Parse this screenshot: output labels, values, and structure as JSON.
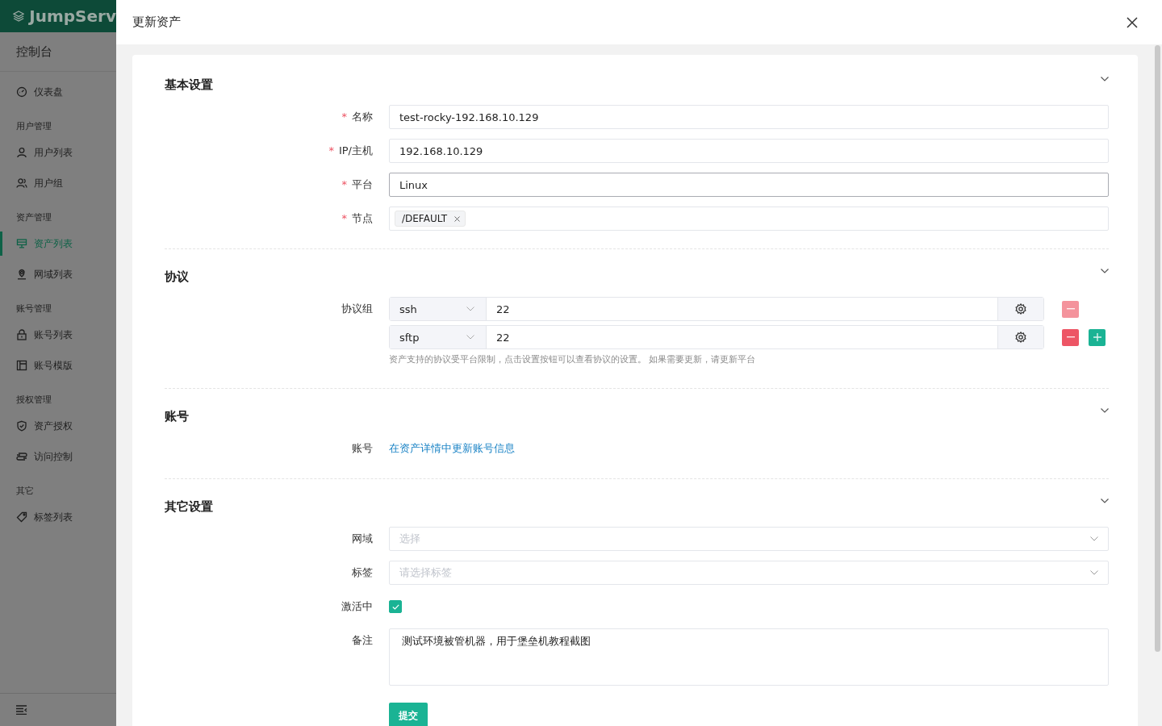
{
  "sidebar": {
    "logo": "JumpServ",
    "title": "控制台",
    "groups": [
      {
        "items": [
          {
            "label": "仪表盘",
            "kind": "dashboard",
            "selected": false
          }
        ]
      },
      {
        "title": "用户管理",
        "items": [
          {
            "label": "用户列表",
            "kind": "user",
            "selected": false
          },
          {
            "label": "用户组",
            "kind": "users",
            "selected": false
          }
        ]
      },
      {
        "title": "资产管理",
        "items": [
          {
            "label": "资产列表",
            "kind": "monitor",
            "selected": true
          },
          {
            "label": "网域列表",
            "kind": "location",
            "selected": false
          }
        ]
      },
      {
        "title": "账号管理",
        "items": [
          {
            "label": "账号列表",
            "kind": "lock",
            "selected": false
          },
          {
            "label": "账号模版",
            "kind": "template",
            "selected": false
          }
        ]
      },
      {
        "title": "授权管理",
        "items": [
          {
            "label": "资产授权",
            "kind": "shield",
            "selected": false
          },
          {
            "label": "访问控制",
            "kind": "access",
            "selected": false
          }
        ]
      },
      {
        "title": "其它",
        "items": [
          {
            "label": "标签列表",
            "kind": "tag",
            "selected": false
          }
        ]
      }
    ]
  },
  "drawer": {
    "title": "更新资产",
    "sections": [
      {
        "title": "基本设置",
        "expanded": true,
        "fields": [
          {
            "kind": "text",
            "label": "名称",
            "required_mark": "*",
            "value": "test-rocky-192.168.10.129",
            "focused": false
          },
          {
            "kind": "text",
            "label": "IP/主机",
            "required_mark": "*",
            "value": "192.168.10.129",
            "focused": false
          },
          {
            "kind": "text",
            "label": "平台",
            "required_mark": "*",
            "value": "Linux",
            "focused": true
          },
          {
            "kind": "tags",
            "label": "节点",
            "required_mark": "*",
            "tags": [
              "/DEFAULT"
            ]
          }
        ]
      },
      {
        "title": "协议",
        "expanded": true,
        "fields": [
          {
            "kind": "protocols",
            "label": "协议组",
            "rows": [
              {
                "protocol": "ssh",
                "port": "22",
                "remove_disabled": true
              },
              {
                "protocol": "sftp",
                "port": "22",
                "remove_disabled": false
              }
            ],
            "help": "资产支持的协议受平台限制，点击设置按钮可以查看协议的设置。 如果需要更新，请更新平台"
          }
        ]
      },
      {
        "title": "账号",
        "expanded": true,
        "fields": [
          {
            "kind": "link",
            "label": "账号",
            "text": "在资产详情中更新账号信息"
          }
        ]
      },
      {
        "title": "其它设置",
        "expanded": true,
        "fields": [
          {
            "kind": "select",
            "label": "网域",
            "placeholder": "选择"
          },
          {
            "kind": "select",
            "label": "标签",
            "placeholder": "请选择标签"
          },
          {
            "kind": "checkbox",
            "label": "激活中",
            "checked": true
          },
          {
            "kind": "textarea",
            "label": "备注",
            "value": "测试环境被管机器，用于堡垒机教程截图"
          }
        ]
      }
    ],
    "submit": "提交"
  }
}
